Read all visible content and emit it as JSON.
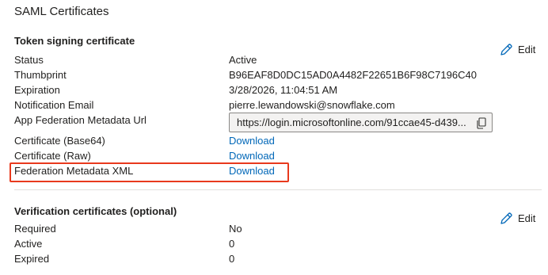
{
  "section": {
    "title": "SAML Certificates"
  },
  "token_signing": {
    "heading": "Token signing certificate",
    "edit_label": "Edit",
    "status": {
      "label": "Status",
      "value": "Active"
    },
    "thumbprint": {
      "label": "Thumbprint",
      "value": "B96EAF8D0DC15AD0A4482F22651B6F98C7196C40"
    },
    "expiration": {
      "label": "Expiration",
      "value": "3/28/2026, 11:04:51 AM"
    },
    "notification_email": {
      "label": "Notification Email",
      "value": "pierre.lewandowski@snowflake.com"
    },
    "metadata_url": {
      "label": "App Federation Metadata Url",
      "value": "https://login.microsoftonline.com/91ccae45-d439..."
    },
    "cert_base64": {
      "label": "Certificate (Base64)",
      "link": "Download"
    },
    "cert_raw": {
      "label": "Certificate (Raw)",
      "link": "Download"
    },
    "federation_xml": {
      "label": "Federation Metadata XML",
      "link": "Download"
    }
  },
  "verification": {
    "heading": "Verification certificates (optional)",
    "edit_label": "Edit",
    "required": {
      "label": "Required",
      "value": "No"
    },
    "active": {
      "label": "Active",
      "value": "0"
    },
    "expired": {
      "label": "Expired",
      "value": "0"
    }
  },
  "icons": {
    "edit": "pencil-icon",
    "copy": "copy-icon"
  },
  "colors": {
    "link": "#0067b8",
    "highlight": "#e8391d",
    "edit_icon": "#0067b8"
  }
}
